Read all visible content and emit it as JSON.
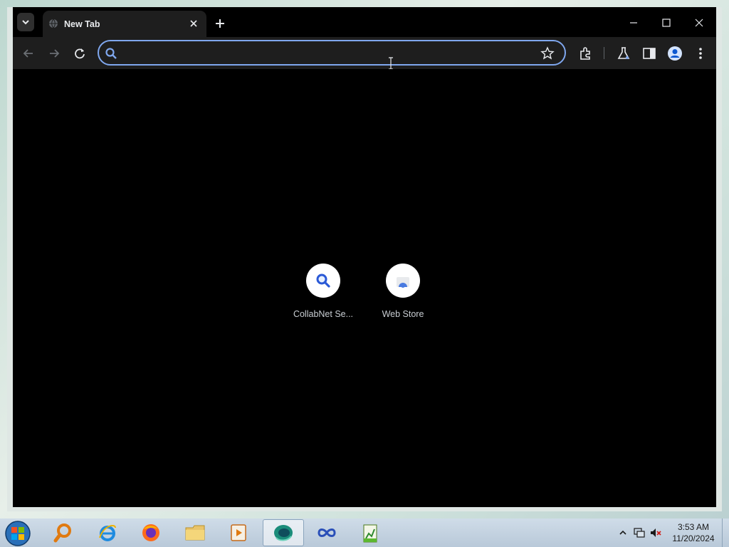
{
  "browser": {
    "tab": {
      "title": "New Tab"
    },
    "omnibox": {
      "value": "",
      "placeholder": ""
    },
    "accent_color": "#7fa7ee"
  },
  "shortcuts": [
    {
      "label": "CollabNet Se...",
      "icon": "search-icon"
    },
    {
      "label": "Web Store",
      "icon": "web-store-icon"
    }
  ],
  "taskbar": {
    "apps": [
      "search-app-icon",
      "internet-explorer-icon",
      "firefox-icon",
      "file-explorer-icon",
      "media-player-icon",
      "browser-app-icon",
      "infinity-app-icon",
      "notepad-chart-icon"
    ],
    "clock": {
      "time": "3:53 AM",
      "date": "11/20/2024"
    }
  }
}
